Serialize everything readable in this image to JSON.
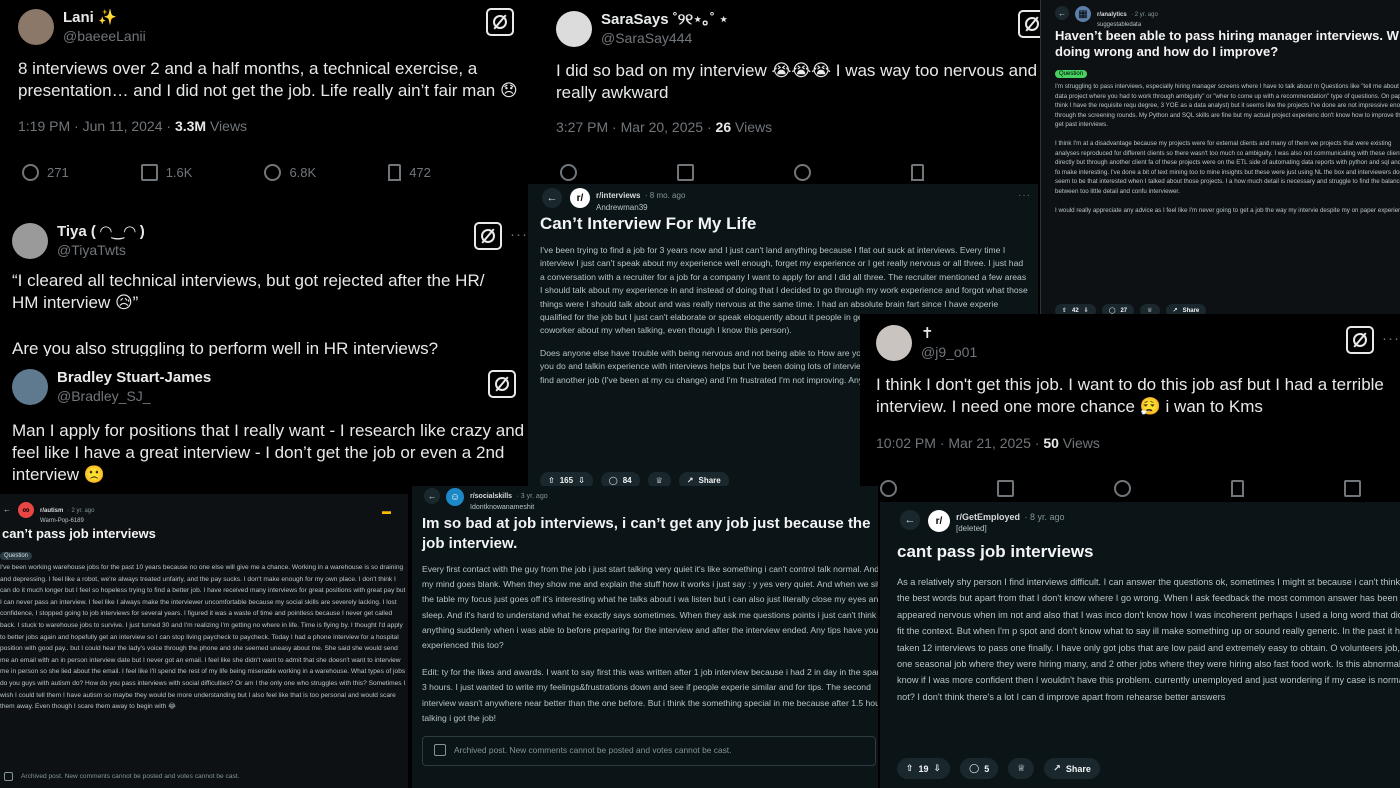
{
  "tweets": {
    "lani": {
      "name": "Lani ✨",
      "handle": "@baeeeLanii",
      "text": "8 interviews over 2 and a half months, a technical exercise, a presentation… and I did not get the job. Life really ain’t fair man 😞",
      "time": "1:19 PM · Jun 11, 2024 · ",
      "views_count": "3.3M",
      "views_label": " Views",
      "replies": "271",
      "reposts": "1.6K",
      "likes": "6.8K",
      "bookmarks": "472"
    },
    "sara": {
      "name": "SaraSays ˚୨୧⋆｡˚ ⋆",
      "handle": "@SaraSay444",
      "text": "I did so bad on my interview 😭😭😭 I was way too nervous and was really awkward",
      "time": "3:27 PM · Mar 20, 2025 · ",
      "views_count": "26",
      "views_label": " Views"
    },
    "tiya": {
      "name": "Tiya ( ◠‿◠ )",
      "handle": "@TiyaTwts",
      "text1": "“I cleared all technical interviews, but got rejected after the HR/ HM interview 😥”",
      "text2": "Are you also struggling to perform well in HR interviews?"
    },
    "bradley": {
      "name": "Bradley Stuart-James",
      "handle": "@Bradley_SJ_",
      "text": "Man I apply for positions that I really want - I research like crazy and feel like I have a great interview - I don’t get the job or even a 2nd interview 🙁"
    },
    "j9": {
      "name": "✝",
      "handle": "@j9_o01",
      "text": "I think I don't get this job. I want to do this job asf but I had a terrible interview. I need one more chance 😮‍💨 i wan to Kms",
      "time": "10:02 PM · Mar 21, 2025 · ",
      "views_count": "50",
      "views_label": " Views"
    }
  },
  "reddit": {
    "analytics": {
      "subreddit": "r/analytics",
      "ago": "· 2 yr. ago",
      "user": "suggestabledata",
      "title": "Haven’t been able to pass hiring manager interviews. W doing wrong and how do I improve?",
      "flair": "Question",
      "p1": "I'm struggling to pass interviews, especially hiring manager screens where I have to talk about m Questions like \"tell me about a data project where you had to work through ambiguity\" or \"wher to come up with a recommendation\" type of questions. On paper I think I have the requisite requ degree, 3 YOE as a data analyst) but it seems like the projects I've done are not impressive enoug through the screening rounds. My Python and SQL skills are fine but my actual project experienc don't know how to improve this to get past interviews.",
      "p2": "I think I'm at a disadvantage because my projects were for external clients and many of them we projects that were existing analyses reproduced for different clients so there wasn't too much co ambiguity. I was also not communicating with these clients directly but through another client fa of these projects were on the ETL side of automating data reports with python and sql and I've fo make interesting. I've done a bit of text mining too to mine insights but these were just using NL the box and interviewers don't seem to be that interested when I talked about those projects. I a how much detail is necessary and struggle to find the balance between too little detail and confu interviewer.",
      "p3": "I would really appreciate any advice as I feel like I'm never going to get a job the way my intervie despite my on paper experience.",
      "votes": "42",
      "comments": "27",
      "share": "Share"
    },
    "interviews": {
      "subreddit": "r/interviews",
      "ago": "· 8 mo. ago",
      "user": "Andrewman39",
      "title": "Can’t Interview For My Life",
      "p1": "I've been trying to find a job for 3 years now and I just can't land anything because I flat out suck at interviews. Every time I interview I just can't speak about my experience well enough, forget my experience or I get really nervous or all three. I just had a conversation with a recruiter for a job for a company I want to apply for and I did all three. The recruiter mentioned a few areas I should talk about my experience in and instead of doing that I decided to go through my work experience and forgot what those things were I should talk about and was really nervous at the same time. I had an absolute brain fart since I have experie qualified for the job but I just can't elaborate or speak eloquently about it people in general sometimes, too (I tried to talk to my coworker about my when talking, even though I know this person).",
      "p2": "Does anyone else have trouble with being nervous and not being able to How are you supposed to get better at describing what you do and talkin experience with interviews helps but I've been doing lots of interviews an feel like I'm never going to be able to find another job (I've been at my cu change) and I'm frustrated I'm not improving. Any advice at all would be",
      "votes": "165",
      "comments": "84",
      "share": "Share"
    },
    "autism": {
      "subreddit": "r/autism",
      "ago": "· 2 yr. ago",
      "user": "Warm-Pop-6189",
      "title": "can’t pass job interviews",
      "flair": "Question",
      "body": "I've been working warehouse jobs for the past 10 years because no one else will give me a chance. Working in a warehouse is so draining and depressing. I feel like a robot, we're always treated unfairly, and the pay sucks. I don't make enough for my own place. I don't think I can do it much longer but I feel so hopeless trying to find a better job. I have received many interviews for great positions with great pay but I can never pass an interview. I feel like I always make the interviewer uncomfortable because my social skills are severely lacking. I lost confidence, I stopped going to job interviews for several years. I figured it was a waste of time and pointless because I never get called back. I stuck to warehouse jobs to survive. I just turned 30 and I'm realizing I'm getting no where in life. Time is flying by. I thought I'd apply to better jobs again and hopefully get an interview so I can stop living paycheck to paycheck. Today I had a phone interview for a hospital position with good pay.. but I could hear the lady's voice through the phone and she seemed uneasy about me. She said she would send me an email with an in person interview date but I never got an email. I feel like she didn't want to admit that she doesn't want to interview me in person so she lied about the email. I feel like I'll spend the rest of my life being miserable working in a warehouse. What types of jobs do you guys with autism do? How do you pass interviews with social difficulties? Or am I the only one who struggles with this? Sometimes I wish I could tell them I have autism so maybe they would be more understanding but I also feel like that is too personal and would scare them away. Even though I scare them away to begin with 😂",
      "archived": "Archived post. New comments cannot be posted and votes cannot be cast."
    },
    "socialskills": {
      "subreddit": "r/socialskills",
      "ago": "· 3 yr. ago",
      "user": "Idontknowanameshit",
      "title": "Im so bad at job interviews, i can’t get any job just because the job interview.",
      "p1": "Every first contact with the guy from the job i just start talking very quiet it's like something i can't control talk normal. And my mind goes blank. When they show me and explain the stuff how it works i just say : y yes very quiet. And when we sit at the table my focus just goes off it's interesting what he talks about i wa listen but i can also just literally close my eyes and sleep. And it's hard to understand what he exactly says sometimes. When they ask me questions points i just can't think of anything suddenly when i was able to before preparing for the interview and after the interview ended. Any tips have you experienced this too?",
      "p2": "Edit: ty for the likes and awards. I want to say first this was written after 1 job interview because i had 2 in day in the span of 3 hours. I just wanted to write my feelings&frustrations down and see if people experie similar and for tips. The second interview wasn't anywhere near better than the one before. But i think the something special in me because after 1.5 hours talking i got the job!",
      "archived": "Archived post. New comments cannot be posted and votes cannot be cast."
    },
    "getemployed": {
      "subreddit": "r/GetEmployed",
      "ago": "· 8 yr. ago",
      "user": "[deleted]",
      "title": "cant pass job interviews",
      "body": "As a relatively shy person I find interviews difficult. I can answer the questions ok, sometimes I might st because i can't think of the best words but apart from that I don't know where I go wrong. When I ask feedback the most common answer has been I appeared nervous when im not and also that I was inco don't know how I was incoherent perhaps I used a long word that didn't fit the context. But when I'm p spot and don't know what to say ill make something up or sound really generic. In the past it has taken 12 interviews to pass one finally. I have only got jobs that are low paid and extremely easy to obtain. O volunteers job, one seasonal job where they were hiring many, and 2 other jobs where they were hiring also fast food work. Is this abnormal? I know if I was more confident then I wouldn't have this problem. currently unemployed and just wondering if my case is normal or not? I don't think there's a lot I can d improve apart from rehearse better answers",
      "votes": "19",
      "comments": "5",
      "share": "Share"
    }
  }
}
